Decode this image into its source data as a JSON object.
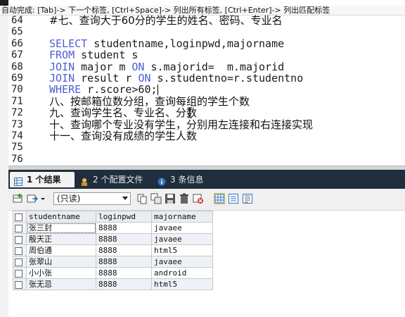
{
  "hint": "自动完成: [Tab]-> 下一个标签, [Ctrl+Space]-> 列出所有标签, [Ctrl+Enter]-> 列出匹配标签",
  "editor": {
    "lines": [
      {
        "num": "64",
        "text": "#七、查询大于60分的学生的姓名、密码、专业名"
      },
      {
        "num": "65",
        "text": ""
      },
      {
        "num": "66",
        "kw": "SELECT",
        "rest": " studentname,loginpwd,majorname"
      },
      {
        "num": "67",
        "kw": "FROM",
        "rest": " student s"
      },
      {
        "num": "68",
        "kw": "JOIN",
        "mid": " major m ",
        "kw2": "ON",
        "rest": " s.majorid=  m.majorid"
      },
      {
        "num": "69",
        "kw": "JOIN",
        "mid": " result r ",
        "kw2": "ON",
        "rest": " s.studentno=r.studentno"
      },
      {
        "num": "70",
        "kw": "WHERE",
        "rest": " r.score>60;"
      },
      {
        "num": "71",
        "text": "八、按邮箱位数分组，查询每组的学生个数"
      },
      {
        "num": "72",
        "text": "九、查询学生名、专业名、分数"
      },
      {
        "num": "73",
        "text": "十、查询哪个专业没有学生，分别用左连接和右连接实现"
      },
      {
        "num": "74",
        "text": "十一、查询没有成绩的学生人数"
      },
      {
        "num": "75",
        "text": ""
      },
      {
        "num": "76",
        "text": ""
      }
    ]
  },
  "tabs": [
    {
      "label": "1 个结果",
      "icon": "result-grid-icon"
    },
    {
      "label": "2 个配置文件",
      "icon": "profile-icon"
    },
    {
      "label": "3 条信息",
      "icon": "info-icon"
    }
  ],
  "toolbar": {
    "mode_value": "(只读)"
  },
  "grid": {
    "columns": [
      "studentname",
      "loginpwd",
      "majorname"
    ],
    "rows": [
      [
        "张三封",
        "8888",
        "javaee"
      ],
      [
        "殷天正",
        "8888",
        "javaee"
      ],
      [
        "周伯通",
        "8888",
        "html5"
      ],
      [
        "张翠山",
        "8888",
        "javaee"
      ],
      [
        "小小张",
        "8888",
        "android"
      ],
      [
        "张无忌",
        "8888",
        "html5"
      ]
    ]
  },
  "colors": {
    "keyword": "#4d5fd0",
    "comment": "#3a8a8a",
    "tabbar": "#1f2d3d"
  }
}
